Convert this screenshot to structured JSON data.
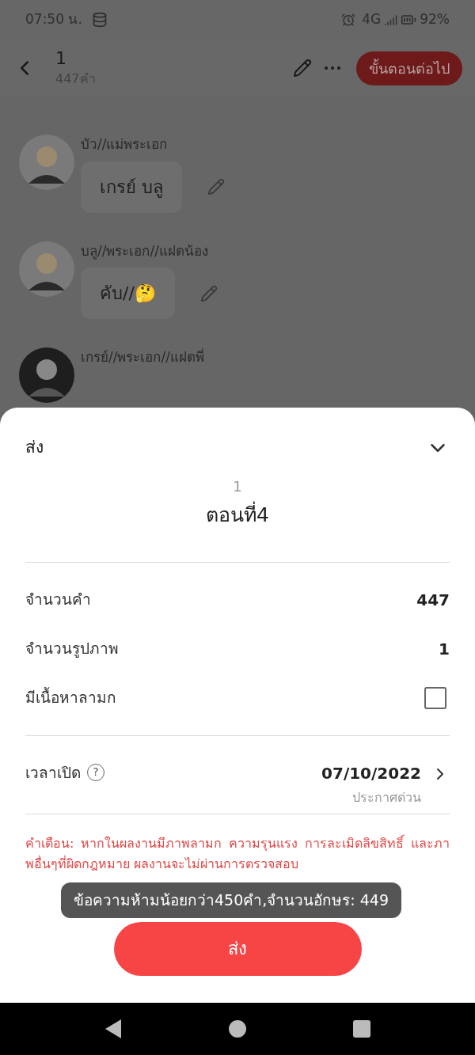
{
  "status_bar": {
    "time": "07:50 น.",
    "network": "4G",
    "battery": "92%"
  },
  "header": {
    "title": "1",
    "subtitle": "447คำ",
    "next_button": "ขั้นตอนต่อไป"
  },
  "messages": [
    {
      "name": "บัว//แม่พระเอก",
      "text": "เกรย์ บลู"
    },
    {
      "name": "บลู//พระเอก//แฝดน้อง",
      "text": "คับ//🤔"
    },
    {
      "name": "เกรย์//พระเอก//แฝดพี่"
    }
  ],
  "sheet": {
    "title": "ส่ง",
    "book": "1",
    "episode": "ตอนที่4",
    "stats": [
      {
        "kind": "value",
        "label": "จำนวนคำ",
        "value": "447"
      },
      {
        "kind": "value",
        "label": "จำนวนรูปภาพ",
        "value": "1"
      },
      {
        "kind": "checkbox",
        "label": "มีเนื้อหาลามก",
        "checked": false
      }
    ],
    "schedule": {
      "label": "เวลาเปิด",
      "help": "?",
      "date": "07/10/2022",
      "note": "ประกาศด่วน"
    },
    "warning": "คำเตือน: หากในผลงานมีภาพลามก ความรุนแรง การละเมิดลิขสิทธิ์ และภาพอื่นๆที่ผิดกฎหมาย ผลงานจะไม่ผ่านการตรวจสอบ",
    "toast": "ข้อความห้ามน้อยกว่า450คำ,จำนวนอักษร: 449",
    "submit": "ส่ง"
  }
}
